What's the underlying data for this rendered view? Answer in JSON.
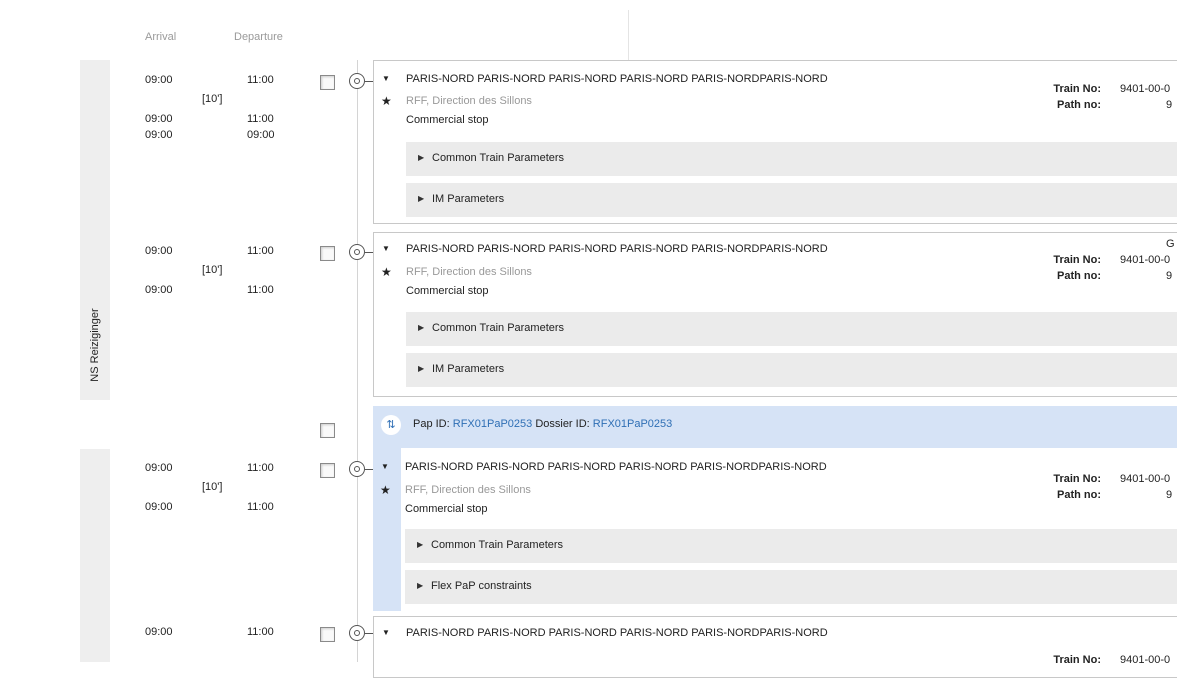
{
  "headers": {
    "arrival": "Arrival",
    "departure": "Departure"
  },
  "sidebar": {
    "group_label": "NS Reiziginger"
  },
  "entries": [
    {
      "arr1": "09:00",
      "dep1": "11:00",
      "dwell": "[10']",
      "arr2": "09:00",
      "dep2": "11:00",
      "arr3": "09:00",
      "dep3": "09:00",
      "title": "PARIS-NORD PARIS-NORD PARIS-NORD PARIS-NORD PARIS-NORDPARIS-NORD",
      "operator": "RFF, Direction des Sillons",
      "stop_type": "Commercial stop",
      "params": [
        "Common Train Parameters",
        "IM Parameters"
      ],
      "train_no_label": "Train No:",
      "train_no": "9401-00-0",
      "path_no_label": "Path no:",
      "path_no": "9"
    },
    {
      "arr1": "09:00",
      "dep1": "11:00",
      "dwell": "[10']",
      "arr2": "09:00",
      "dep2": "11:00",
      "title": "PARIS-NORD PARIS-NORD PARIS-NORD PARIS-NORD PARIS-NORDPARIS-NORD",
      "operator": "RFF, Direction des Sillons",
      "stop_type": "Commercial stop",
      "params": [
        "Common Train Parameters",
        "IM Parameters"
      ],
      "corner_glyph": "G",
      "train_no_label": "Train No:",
      "train_no": "9401-00-0",
      "path_no_label": "Path no:",
      "path_no": "9"
    },
    {
      "arr1": "09:00",
      "dep1": "11:00",
      "dwell": "[10']",
      "arr2": "09:00",
      "dep2": "11:00",
      "title": "PARIS-NORD PARIS-NORD PARIS-NORD PARIS-NORD PARIS-NORDPARIS-NORD",
      "operator": "RFF, Direction des Sillons",
      "stop_type": "Commercial stop",
      "params": [
        "Common Train Parameters",
        "Flex PaP constraints"
      ],
      "train_no_label": "Train No:",
      "train_no": "9401-00-0",
      "path_no_label": "Path no:",
      "path_no": "9"
    },
    {
      "arr1": "09:00",
      "dep1": "11:00",
      "title": "PARIS-NORD PARIS-NORD PARIS-NORD PARIS-NORD PARIS-NORDPARIS-NORD",
      "train_no_label": "Train No:",
      "train_no": "9401-00-0"
    }
  ],
  "pap": {
    "pap_label": "Pap ID:",
    "pap_id": "RFX01PaP0253",
    "dossier_label": "Dossier ID:",
    "dossier_id": "RFX01PaP0253"
  },
  "colors": {
    "pap_band": "#d6e3f6",
    "link": "#2f6fb5",
    "param_bg": "#ebebeb"
  }
}
